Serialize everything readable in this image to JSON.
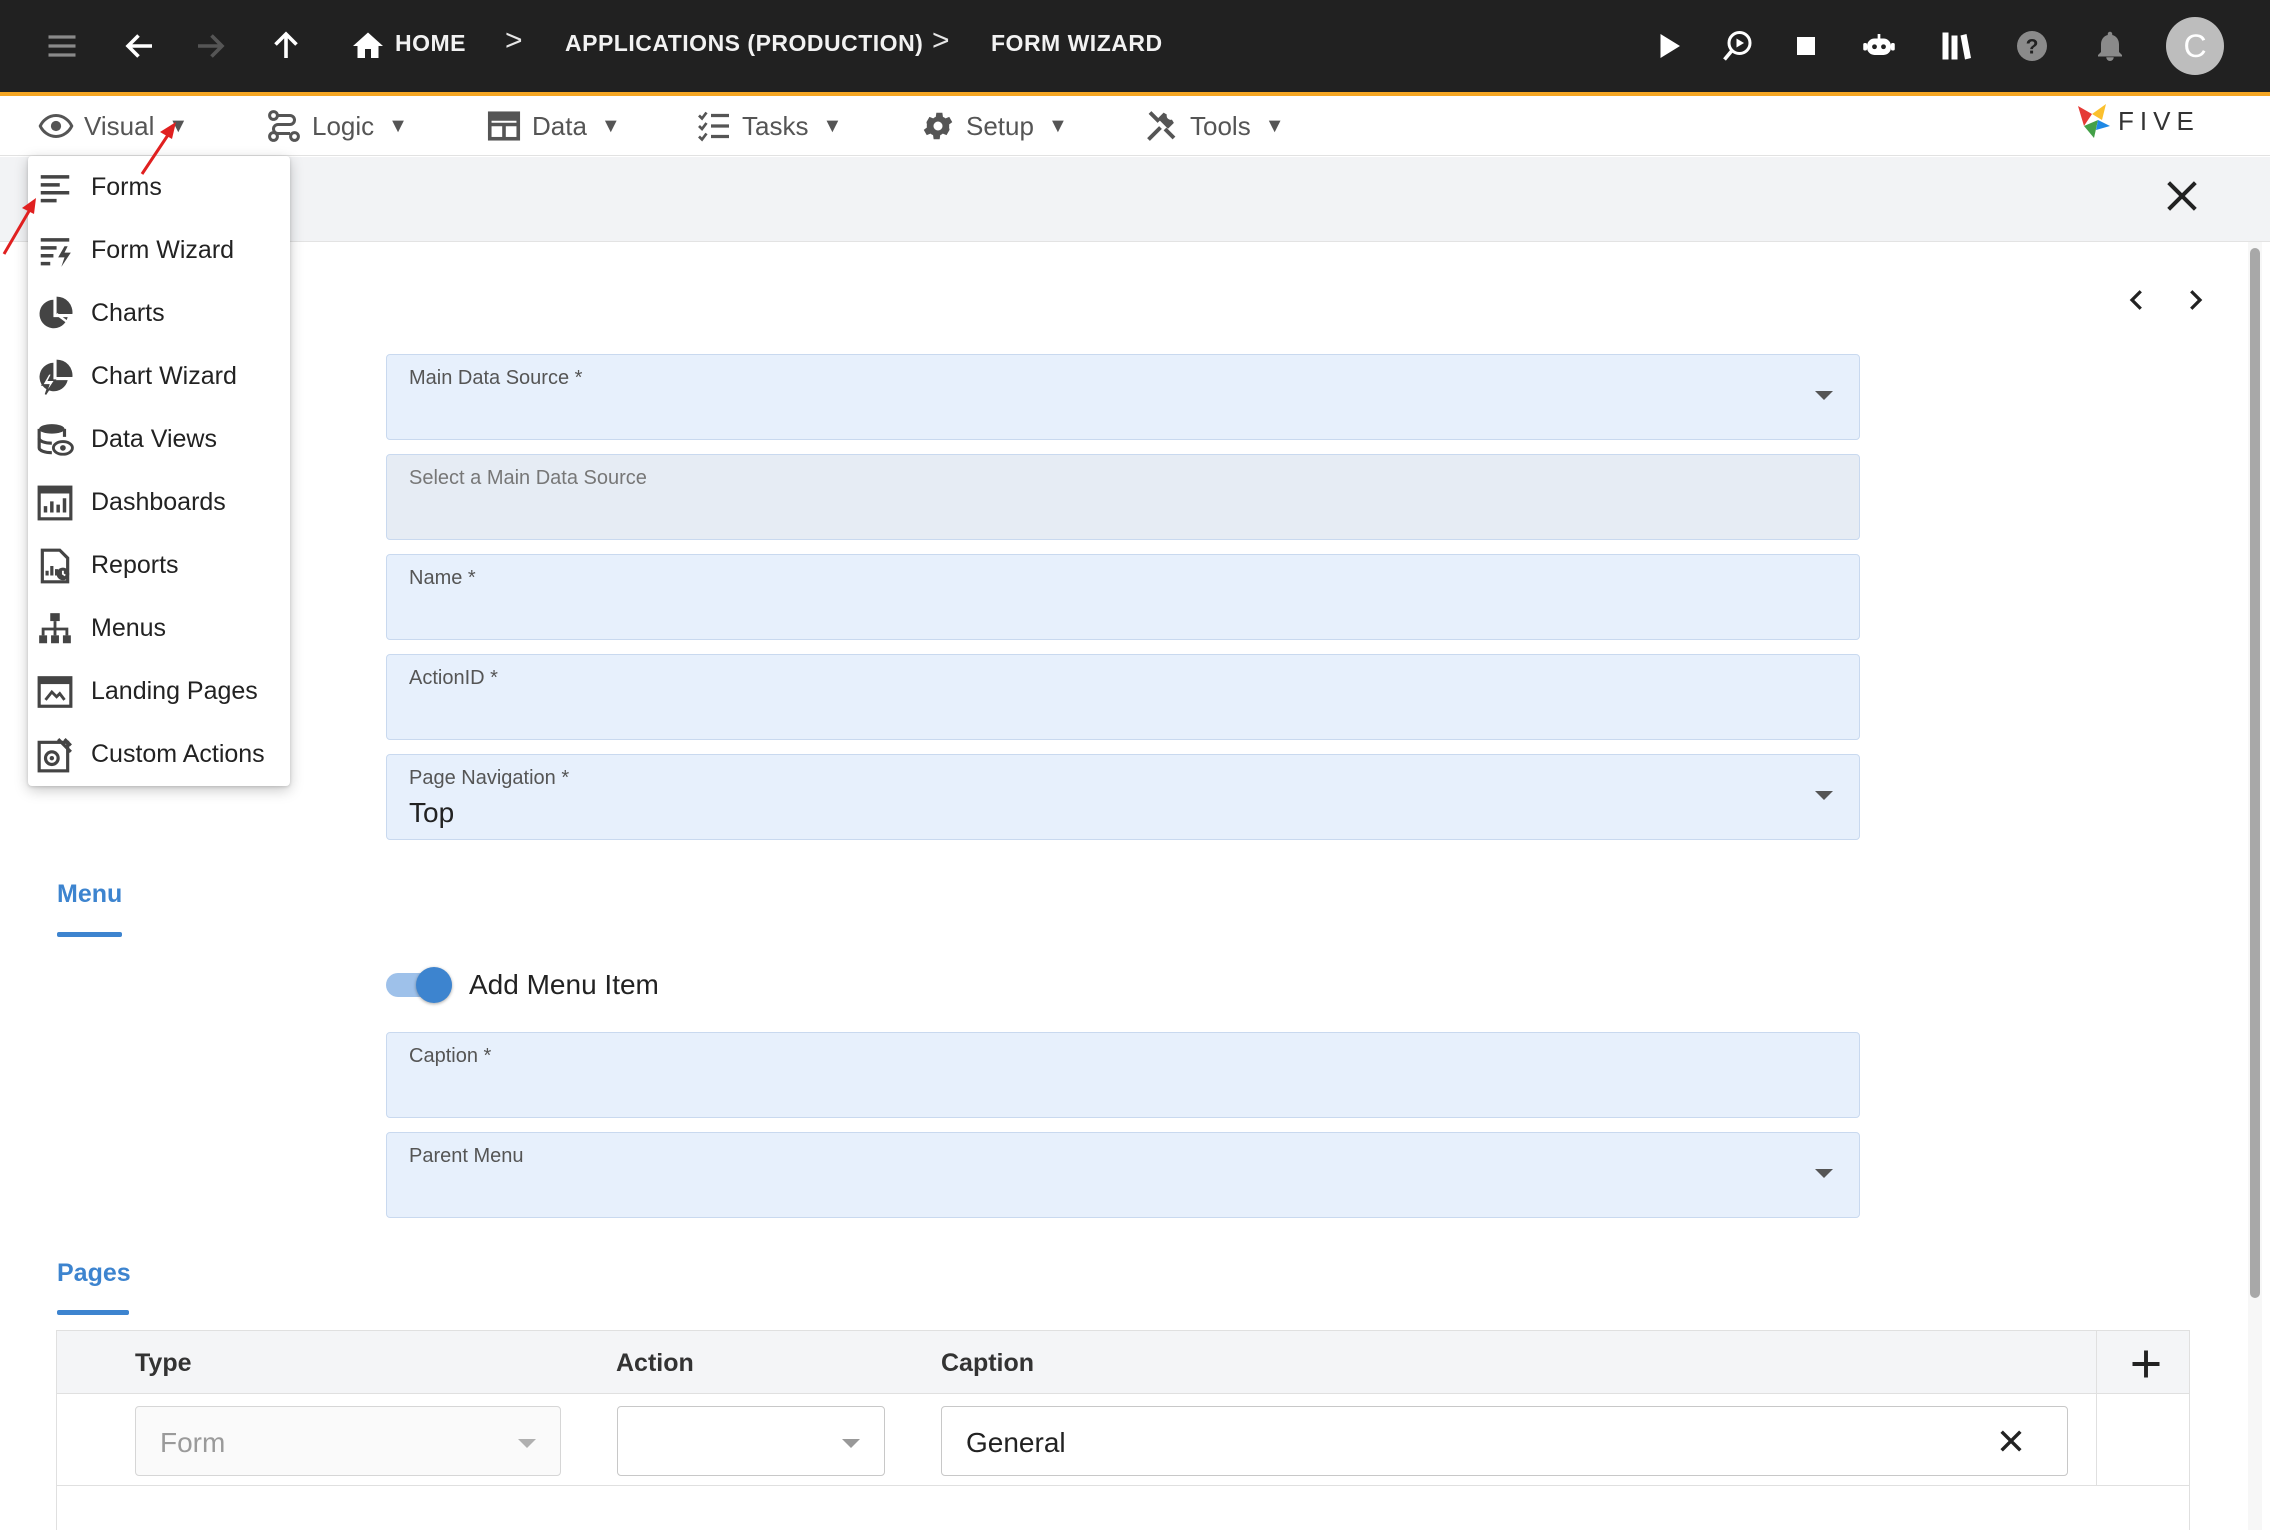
{
  "topbar": {
    "breadcrumb": [
      "HOME",
      "APPLICATIONS (PRODUCTION)",
      "FORM WIZARD"
    ],
    "separator": ">",
    "avatar_initial": "C",
    "icons": [
      "hamburger-icon",
      "back-arrow-icon",
      "forward-arrow-icon",
      "up-arrow-icon",
      "home-icon",
      "play-icon",
      "debug-run-icon",
      "stop-icon",
      "chatbot-icon",
      "library-icon",
      "help-icon",
      "bell-icon"
    ],
    "accent_color": "#f5a623",
    "background_color": "#212121"
  },
  "menubar": {
    "items": [
      {
        "label": "Visual",
        "icon": "eye-icon"
      },
      {
        "label": "Logic",
        "icon": "logic-icon"
      },
      {
        "label": "Data",
        "icon": "table-icon"
      },
      {
        "label": "Tasks",
        "icon": "checklist-icon"
      },
      {
        "label": "Setup",
        "icon": "gear-icon"
      },
      {
        "label": "Tools",
        "icon": "tools-icon"
      }
    ],
    "caret": "▼",
    "logo_text": "FIVE"
  },
  "visual_dropdown": {
    "items": [
      {
        "label": "Forms",
        "icon": "forms-icon"
      },
      {
        "label": "Form Wizard",
        "icon": "form-wizard-icon"
      },
      {
        "label": "Charts",
        "icon": "charts-icon"
      },
      {
        "label": "Chart Wizard",
        "icon": "chart-wizard-icon"
      },
      {
        "label": "Data Views",
        "icon": "data-views-icon"
      },
      {
        "label": "Dashboards",
        "icon": "dashboards-icon"
      },
      {
        "label": "Reports",
        "icon": "reports-icon"
      },
      {
        "label": "Menus",
        "icon": "menus-icon"
      },
      {
        "label": "Landing Pages",
        "icon": "landing-pages-icon"
      },
      {
        "label": "Custom Actions",
        "icon": "custom-actions-icon"
      }
    ]
  },
  "form": {
    "fields": {
      "main_data_source": {
        "label": "Main Data Source *",
        "value": ""
      },
      "select_source": {
        "label": "Select a Main Data Source",
        "value": ""
      },
      "name": {
        "label": "Name *",
        "value": ""
      },
      "action_id": {
        "label": "ActionID *",
        "value": ""
      },
      "page_navigation": {
        "label": "Page Navigation *",
        "value": "Top"
      }
    },
    "menu_section": {
      "tab_label": "Menu",
      "toggle_label": "Add Menu Item",
      "toggle_on": true,
      "caption": {
        "label": "Caption *",
        "value": ""
      },
      "parent_menu": {
        "label": "Parent Menu",
        "value": ""
      }
    },
    "pages_section": {
      "tab_label": "Pages",
      "columns": [
        "Type",
        "Action",
        "Caption"
      ],
      "rows": [
        {
          "type": "Form",
          "action": "",
          "caption": "General"
        }
      ]
    }
  },
  "colors": {
    "accent_blue": "#3d84cf",
    "field_background": "#e7f0fc",
    "annotation_red": "#e02020"
  }
}
